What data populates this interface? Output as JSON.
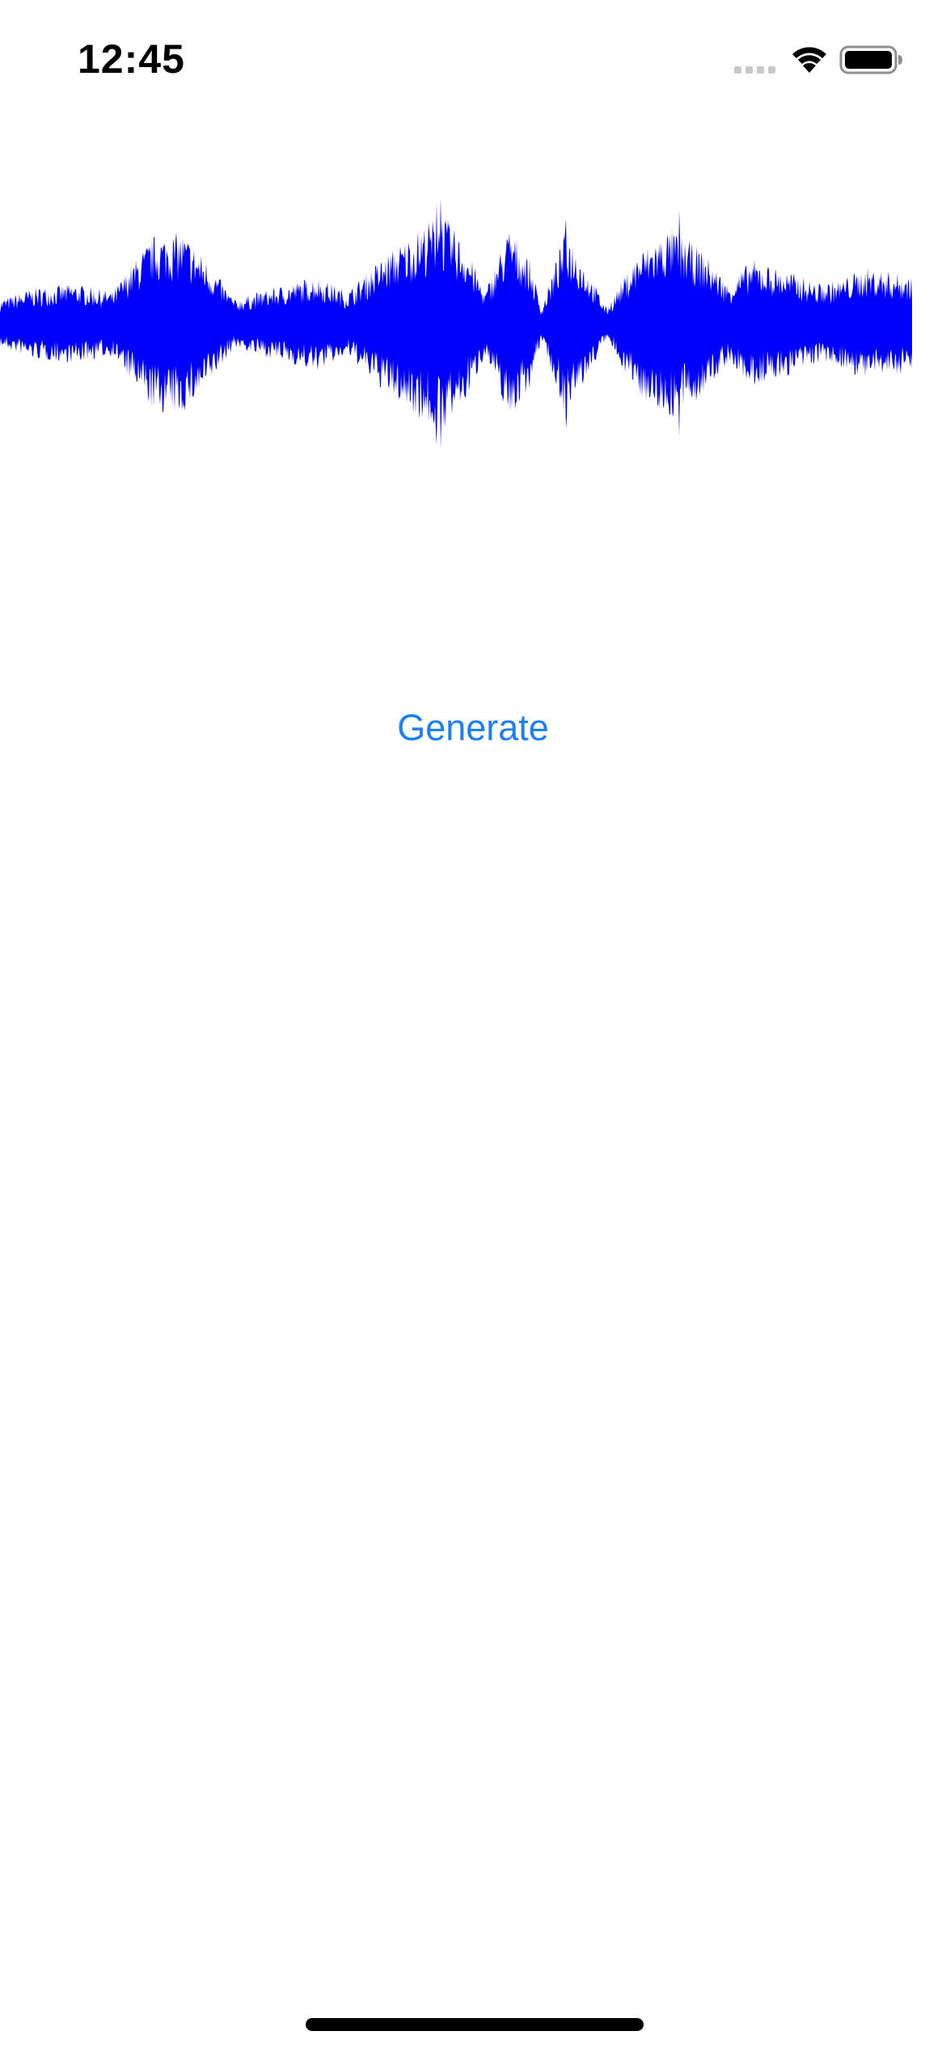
{
  "status_bar": {
    "time": "12:45",
    "icons": [
      "signal-icon",
      "wifi-icon",
      "battery-icon"
    ]
  },
  "waveform": {
    "color": "#0000ff",
    "icon": "audio-waveform"
  },
  "main": {
    "generate_label": "Generate",
    "accent_color": "#1e7ff0"
  }
}
